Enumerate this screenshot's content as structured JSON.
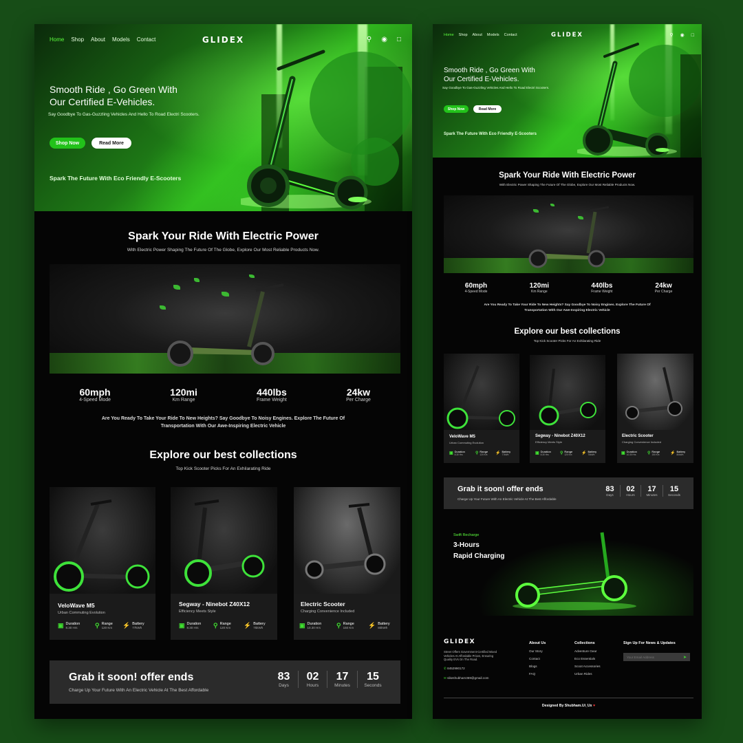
{
  "nav": {
    "links": [
      "Home",
      "Shop",
      "About",
      "Models",
      "Contact"
    ],
    "logo": "GLIDEX",
    "icons": [
      "search-icon",
      "user-icon",
      "cart-icon"
    ]
  },
  "hero": {
    "title_line1": "Smooth Ride , Go Green With",
    "title_line2": "Our Certified E-Vehicles.",
    "subtitle": "Say Goodbye To Gas-Guzzling Vehicles And Hello To Road Electri Scooters.",
    "shop_button": "Shop Now",
    "read_button": "Read More",
    "tagline": "Spark The Future With Eco Friendly E-Scooters"
  },
  "power": {
    "title": "Spark Your Ride With Electric Power",
    "subtitle": "With Electric Power Shaping The Future Of The Globe, Explore Our Most Reliable Products Now."
  },
  "stats": [
    {
      "value": "60mph",
      "label": "4-Speed Mode"
    },
    {
      "value": "120mi",
      "label": "Km Range"
    },
    {
      "value": "440lbs",
      "label": "Frame Weight"
    },
    {
      "value": "24kw",
      "label": "Per Charge"
    }
  ],
  "blurb_line1": "Are You Ready To Take Your Ride To New Heights? Say Goodbye To Noisy Engines. Explore The Future Of",
  "blurb_line2": "Transportation With Our Awe-Inspiring Electric Vehicle",
  "collections": {
    "title": "Explore our best collections",
    "subtitle": "Top Kick Scooter Picks For An Exhilarating Ride",
    "items": [
      {
        "name": "VeloWave M5",
        "desc": "Urban Commuting Evolution",
        "specs": [
          {
            "t": "Duration",
            "s": "8.30 Hrs"
          },
          {
            "t": "Range",
            "s": "120 Km"
          },
          {
            "t": "Battery",
            "s": "77kWh"
          }
        ]
      },
      {
        "name": "Segway - Ninebot Z40X12",
        "desc": "Efficiency Meets Style",
        "specs": [
          {
            "t": "Duration",
            "s": "8.30 Hrs"
          },
          {
            "t": "Range",
            "s": "120 Km"
          },
          {
            "t": "Battery",
            "s": "75kWh"
          }
        ]
      },
      {
        "name": "Electric Scooter",
        "desc": "Charging Convenience Included",
        "specs": [
          {
            "t": "Duration",
            "s": "10.30 Hrs"
          },
          {
            "t": "Range",
            "s": "150 Km"
          },
          {
            "t": "Battery",
            "s": "80kWh"
          }
        ]
      }
    ]
  },
  "offer": {
    "title": "Grab it soon! offer ends",
    "subtitle": "Charge Up Your Future With An Electric Vehicle At The Best Affordable",
    "countdown": [
      {
        "n": "83",
        "u": "Days"
      },
      {
        "n": "02",
        "u": "Hours"
      },
      {
        "n": "17",
        "u": "Minutes"
      },
      {
        "n": "15",
        "u": "Seconds"
      }
    ]
  },
  "charging": {
    "kicker": "Swift Recharge",
    "line1": "3-Hours",
    "line2": "Rapid Charging"
  },
  "footer": {
    "logo": "GLIDEX",
    "about_line1": "Street Offers Government-Certified Mixed",
    "about_line2": "Vehicles At Affordable Prices, Ensuring",
    "about_line3": "Quality EVs On The Road.",
    "phone": "8452990172",
    "email": "sikeshubham369@gmail.com",
    "col1_title": "About Us",
    "col1": [
      "Our Story",
      "Contact",
      "Blogs",
      "FAQ"
    ],
    "col2_title": "Collections",
    "col2": [
      "Adventure Gear",
      "Eco Essentials",
      "Scoot Accessories",
      "Urban Rides"
    ],
    "newsletter_title": "Sign Up For News & Updates",
    "email_placeholder": "Your Email Address",
    "credit": "Designed By Shubham.Ui_Ux"
  },
  "colors": {
    "accent": "#22c21a",
    "page_bg": "#174d17",
    "section_bg": "#050505"
  }
}
